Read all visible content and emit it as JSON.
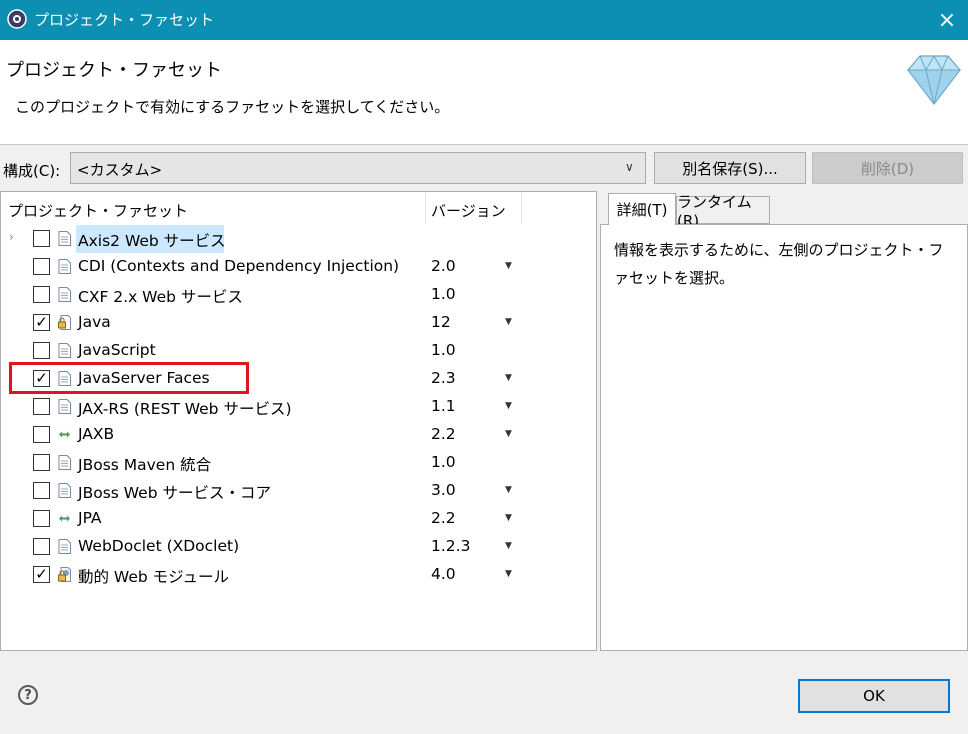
{
  "window": {
    "title": "プロジェクト・ファセット",
    "close_icon": "×"
  },
  "header": {
    "title": "プロジェクト・ファセット",
    "description": "このプロジェクトで有効にするファセットを選択してください。"
  },
  "config": {
    "label": "構成(C):",
    "value": "<カスタム>",
    "save_as_label": "別名保存(S)...",
    "delete_label": "削除(D)"
  },
  "table": {
    "columns": {
      "facet": "プロジェクト・ファセット",
      "version": "バージョン"
    },
    "rows": [
      {
        "name": "Axis2 Web サービス",
        "version": "",
        "checked": false,
        "dropdown": false,
        "icon": "page-icon"
      },
      {
        "name": "CDI (Contexts and Dependency Injection)",
        "version": "2.0",
        "checked": false,
        "dropdown": true,
        "icon": "page-icon"
      },
      {
        "name": "CXF 2.x Web サービス",
        "version": "1.0",
        "checked": false,
        "dropdown": false,
        "icon": "page-icon"
      },
      {
        "name": "Java",
        "version": "12",
        "checked": true,
        "dropdown": true,
        "icon": "java-lock-icon"
      },
      {
        "name": "JavaScript",
        "version": "1.0",
        "checked": false,
        "dropdown": false,
        "icon": "page-icon"
      },
      {
        "name": "JavaServer Faces",
        "version": "2.3",
        "checked": true,
        "dropdown": true,
        "icon": "page-icon"
      },
      {
        "name": "JAX-RS (REST Web サービス)",
        "version": "1.1",
        "checked": false,
        "dropdown": true,
        "icon": "page-icon"
      },
      {
        "name": "JAXB",
        "version": "2.2",
        "checked": false,
        "dropdown": true,
        "icon": "arrows-icon"
      },
      {
        "name": "JBoss Maven 統合",
        "version": "1.0",
        "checked": false,
        "dropdown": false,
        "icon": "page-icon"
      },
      {
        "name": "JBoss Web サービス・コア",
        "version": "3.0",
        "checked": false,
        "dropdown": true,
        "icon": "page-icon"
      },
      {
        "name": "JPA",
        "version": "2.2",
        "checked": false,
        "dropdown": true,
        "icon": "arrows-icon"
      },
      {
        "name": "WebDoclet (XDoclet)",
        "version": "1.2.3",
        "checked": false,
        "dropdown": true,
        "icon": "page-icon"
      },
      {
        "name": "動的 Web モジュール",
        "version": "4.0",
        "checked": true,
        "dropdown": true,
        "icon": "web-module-lock-icon"
      }
    ]
  },
  "tabs": {
    "details": "詳細(T)",
    "runtime": "ランタイム(R)"
  },
  "details_text": "情報を表示するために、左側のプロジェクト・ファセットを選択。",
  "footer": {
    "help_label": "?",
    "ok_label": "OK"
  },
  "colors": {
    "titlebar": "#0c8fb2",
    "highlight": "#e0141e",
    "ok_border": "#0078d7"
  }
}
